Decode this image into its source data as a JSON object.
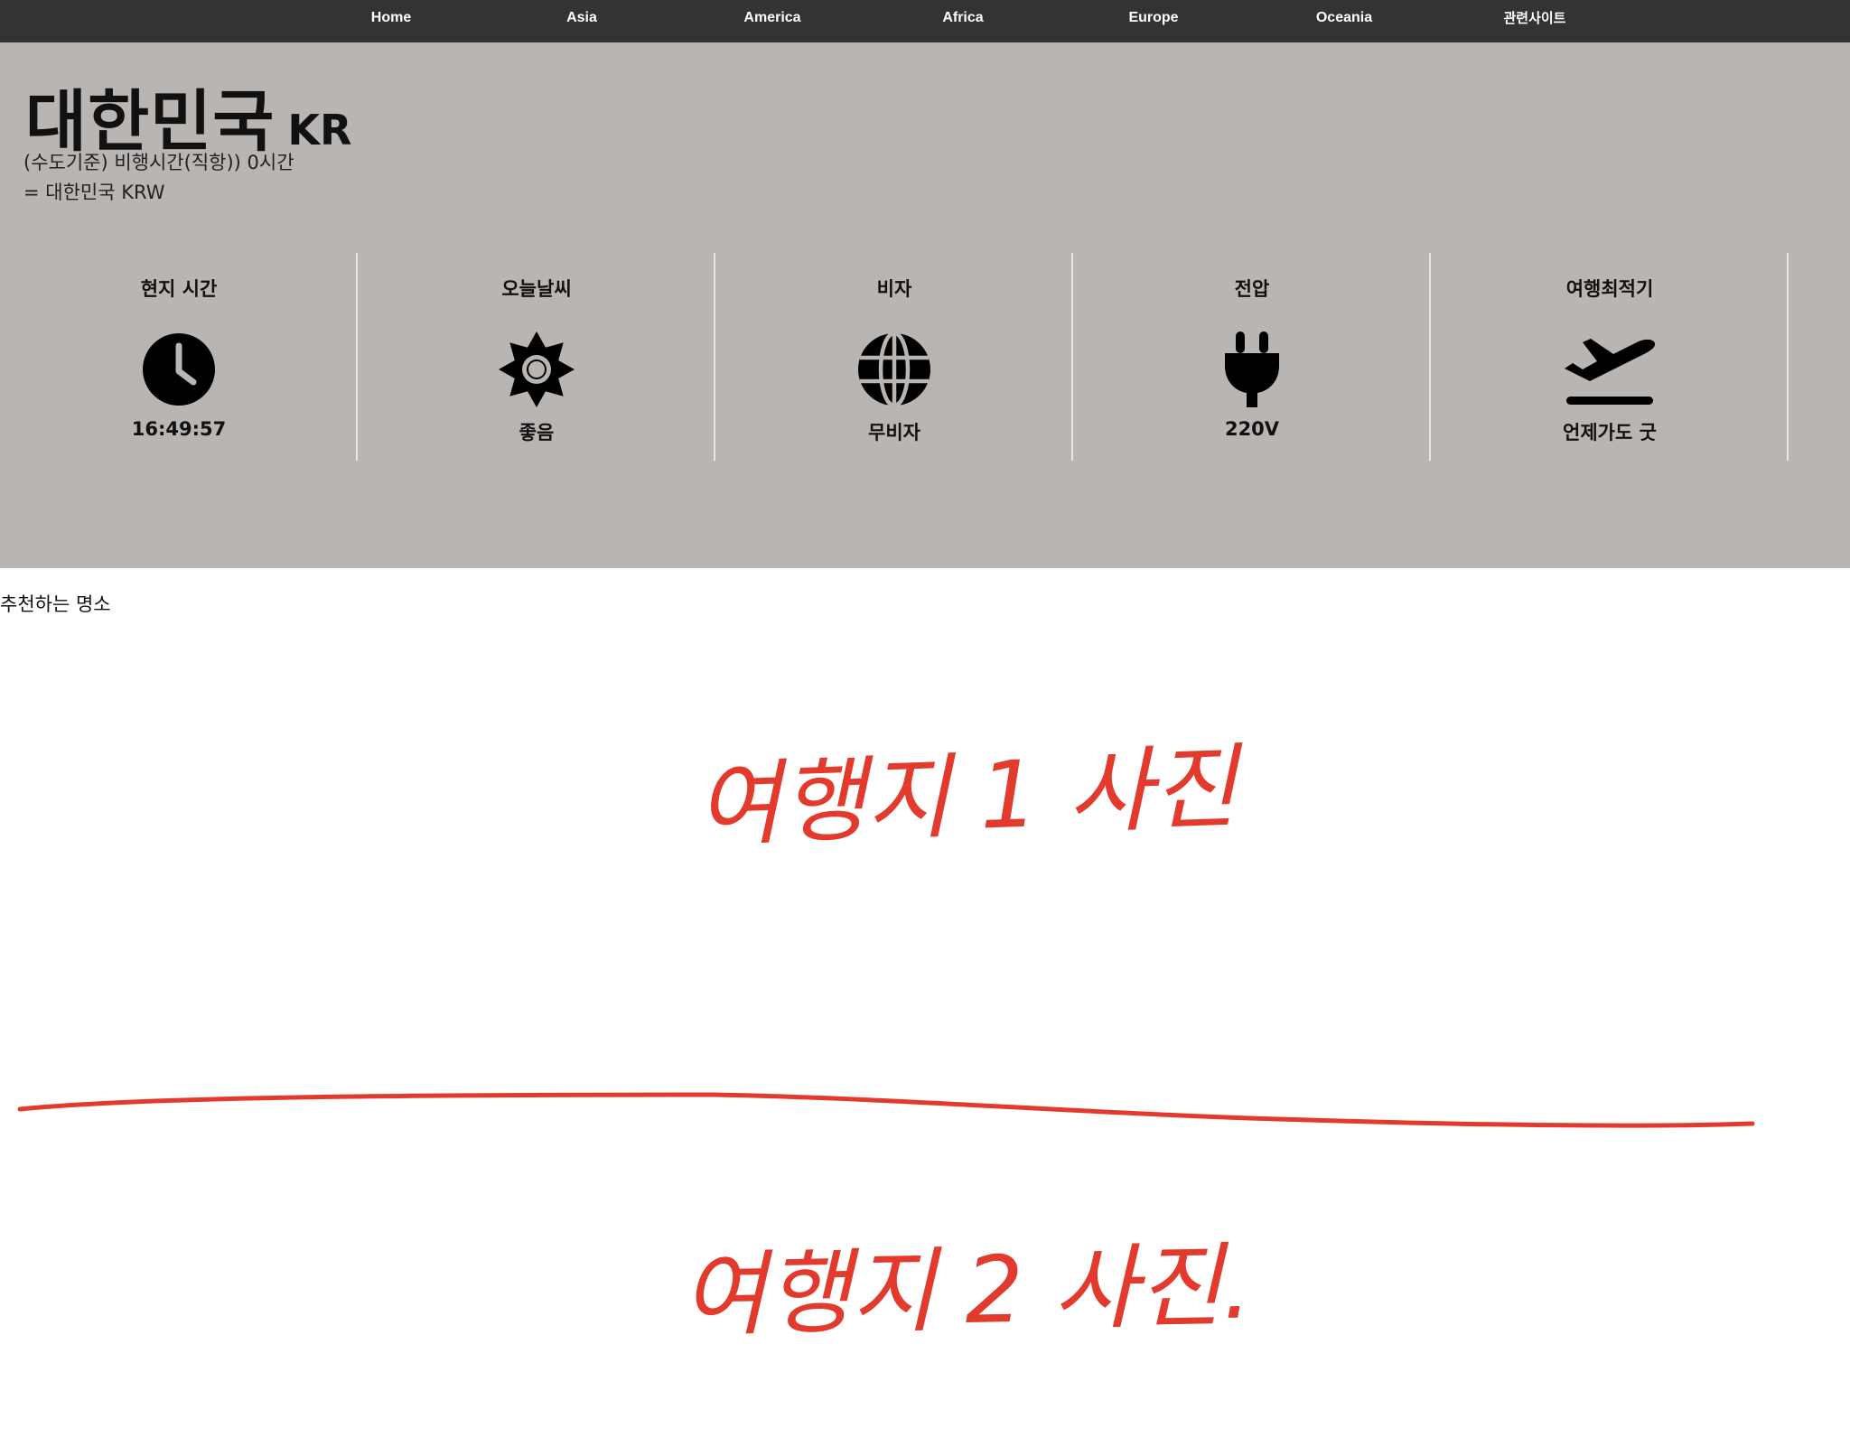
{
  "nav": {
    "items": [
      {
        "label": "Home"
      },
      {
        "label": "Asia"
      },
      {
        "label": "America"
      },
      {
        "label": "Africa"
      },
      {
        "label": "Europe"
      },
      {
        "label": "Oceania"
      },
      {
        "label": "관련사이트"
      }
    ]
  },
  "country": {
    "name": "대한민국",
    "code": "KR",
    "flight_info": "(수도기준) 비행시간(직항)) 0시간",
    "currency_info": "= 대한민국 KRW"
  },
  "cards": [
    {
      "title": "현지 시간",
      "icon": "clock-icon",
      "value": "16:49:57"
    },
    {
      "title": "오늘날씨",
      "icon": "sun-icon",
      "value": "좋음"
    },
    {
      "title": "비자",
      "icon": "globe-icon",
      "value": "무비자"
    },
    {
      "title": "전압",
      "icon": "plug-icon",
      "value": "220V"
    },
    {
      "title": "여행최적기",
      "icon": "plane-departure-icon",
      "value": "언제가도 굿"
    }
  ],
  "recommend": {
    "title": "추천하는 명소",
    "placeholders": [
      "여행지 1 사진",
      "여행지 2 사진."
    ]
  },
  "colors": {
    "nav_bg": "#333333",
    "hero_bg": "#b9b5b3",
    "handwriting": "#e23a2c"
  }
}
